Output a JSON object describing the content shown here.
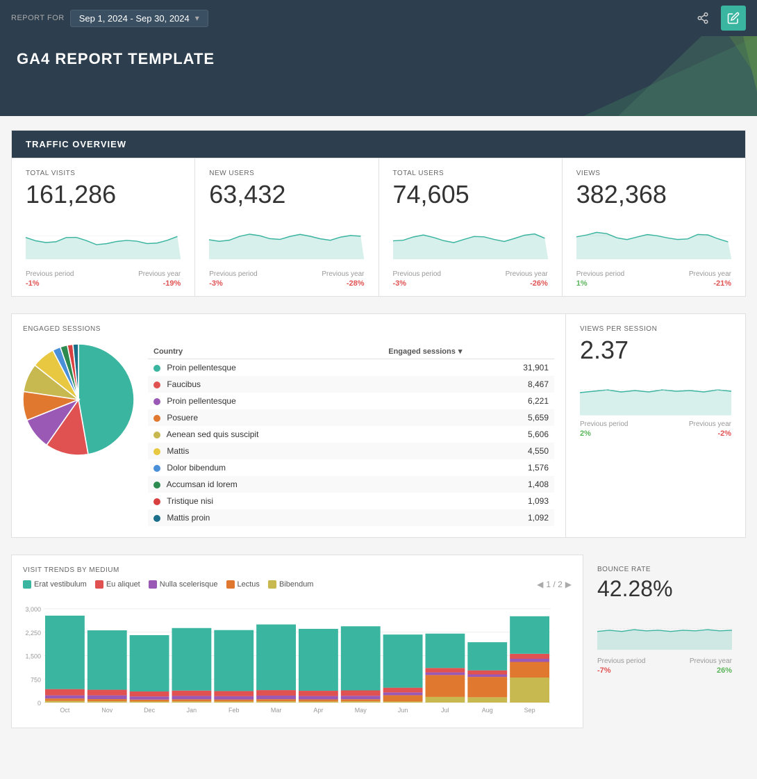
{
  "header": {
    "report_for_label": "REPORT FOR",
    "date_range": "Sep 1, 2024 - Sep 30, 2024",
    "share_icon": "⋮",
    "edit_icon": "✎"
  },
  "hero": {
    "title": "GA4 REPORT TEMPLATE"
  },
  "traffic_overview": {
    "section_title": "TRAFFIC OVERVIEW",
    "cards": [
      {
        "label": "TOTAL VISITS",
        "value": "161,286",
        "prev_period_label": "Previous period",
        "prev_period_change": "-1%",
        "prev_period_neg": true,
        "prev_year_label": "Previous year",
        "prev_year_change": "-19%",
        "prev_year_neg": true
      },
      {
        "label": "NEW USERS",
        "value": "63,432",
        "prev_period_label": "Previous period",
        "prev_period_change": "-3%",
        "prev_period_neg": true,
        "prev_year_label": "Previous year",
        "prev_year_change": "-28%",
        "prev_year_neg": true
      },
      {
        "label": "TOTAL USERS",
        "value": "74,605",
        "prev_period_label": "Previous period",
        "prev_period_change": "-3%",
        "prev_period_neg": true,
        "prev_year_label": "Previous year",
        "prev_year_change": "-26%",
        "prev_year_neg": true
      },
      {
        "label": "VIEWS",
        "value": "382,368",
        "prev_period_label": "Previous period",
        "prev_period_change": "1%",
        "prev_period_neg": false,
        "prev_year_label": "Previous year",
        "prev_year_change": "-21%",
        "prev_year_neg": true
      }
    ]
  },
  "engaged_sessions": {
    "section_label": "ENGAGED SESSIONS",
    "table_col1": "Country",
    "table_col2": "Engaged sessions",
    "rows": [
      {
        "color": "#3ab5a0",
        "country": "Proin pellentesque",
        "value": "31,901"
      },
      {
        "color": "#e05252",
        "country": "Faucibus",
        "value": "8,467"
      },
      {
        "color": "#9b59b6",
        "country": "Proin pellentesque",
        "value": "6,221"
      },
      {
        "color": "#e07830",
        "country": "Posuere",
        "value": "5,659"
      },
      {
        "color": "#c8b850",
        "country": "Aenean sed quis suscipit",
        "value": "5,606"
      },
      {
        "color": "#e8c840",
        "country": "Mattis",
        "value": "4,550"
      },
      {
        "color": "#4a90d9",
        "country": "Dolor bibendum",
        "value": "1,576"
      },
      {
        "color": "#2d8a50",
        "country": "Accumsan id lorem",
        "value": "1,408"
      },
      {
        "color": "#d94040",
        "country": "Tristique nisi",
        "value": "1,093"
      },
      {
        "color": "#1a6e8a",
        "country": "Mattis proin",
        "value": "1,092"
      }
    ]
  },
  "views_per_session": {
    "label": "VIEWS PER SESSION",
    "value": "2.37",
    "prev_period_label": "Previous period",
    "prev_period_change": "2%",
    "prev_period_neg": false,
    "prev_year_label": "Previous year",
    "prev_year_change": "-2%",
    "prev_year_neg": true
  },
  "visit_trends": {
    "label": "VISIT TRENDS BY MEDIUM",
    "legend": [
      {
        "color": "#3ab5a0",
        "label": "Erat vestibulum"
      },
      {
        "color": "#e05252",
        "label": "Eu aliquet"
      },
      {
        "color": "#9b59b6",
        "label": "Nulla scelerisque"
      },
      {
        "color": "#e07830",
        "label": "Lectus"
      },
      {
        "color": "#c8b850",
        "label": "Bibendum"
      }
    ],
    "page_indicator": "1 / 2",
    "y_labels": [
      "3,000",
      "2,250",
      "1,500",
      "750",
      "0"
    ],
    "x_labels": [
      "Oct",
      "Nov",
      "Dec",
      "Jan",
      "Feb",
      "Mar",
      "Apr",
      "May",
      "Jun",
      "Jul",
      "Aug",
      "Sep"
    ],
    "bars": [
      {
        "month": "Oct",
        "segments": [
          2350,
          200,
          100,
          80,
          50
        ]
      },
      {
        "month": "Nov",
        "segments": [
          1900,
          180,
          120,
          70,
          40
        ]
      },
      {
        "month": "Dec",
        "segments": [
          1800,
          160,
          100,
          60,
          35
        ]
      },
      {
        "month": "Jan",
        "segments": [
          2000,
          170,
          110,
          65,
          38
        ]
      },
      {
        "month": "Feb",
        "segments": [
          1950,
          165,
          105,
          62,
          36
        ]
      },
      {
        "month": "Mar",
        "segments": [
          2100,
          175,
          115,
          68,
          40
        ]
      },
      {
        "month": "Apr",
        "segments": [
          1980,
          168,
          108,
          64,
          37
        ]
      },
      {
        "month": "May",
        "segments": [
          2050,
          172,
          112,
          66,
          39
        ]
      },
      {
        "month": "Jun",
        "segments": [
          1700,
          150,
          90,
          200,
          35
        ]
      },
      {
        "month": "Jul",
        "segments": [
          1100,
          140,
          85,
          700,
          180
        ]
      },
      {
        "month": "Aug",
        "segments": [
          900,
          130,
          80,
          650,
          170
        ]
      },
      {
        "month": "Sep",
        "segments": [
          1200,
          160,
          100,
          500,
          800
        ]
      }
    ]
  },
  "bounce_rate": {
    "label": "BOUNCE RATE",
    "value": "42.28%",
    "prev_period_label": "Previous period",
    "prev_period_change": "-7%",
    "prev_period_neg": true,
    "prev_year_label": "Previous year",
    "prev_year_change": "26%",
    "prev_year_neg": false
  }
}
